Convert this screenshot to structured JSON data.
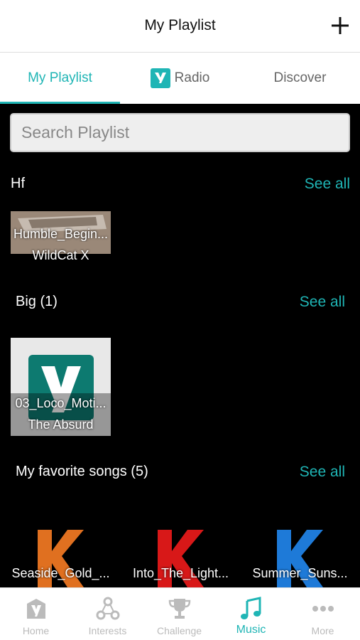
{
  "header": {
    "title": "My Playlist"
  },
  "tabs": [
    {
      "label": "My Playlist"
    },
    {
      "label": "Radio"
    },
    {
      "label": "Discover"
    }
  ],
  "search": {
    "placeholder": "Search Playlist"
  },
  "sections": [
    {
      "title": "Hf",
      "see_all": "See all",
      "items": [
        {
          "title": "Humble_Begin...",
          "artist": "WildCat X"
        }
      ]
    },
    {
      "title": "Big (1)",
      "see_all": "See all",
      "items": [
        {
          "title": "03_Loco_Moti...",
          "artist": "The Absurd"
        }
      ]
    },
    {
      "title": "My favorite songs (5)",
      "see_all": "See all",
      "items": [
        {
          "title": "Seaside_Gold_..."
        },
        {
          "title": "Into_The_Light..."
        },
        {
          "title": "Summer_Suns..."
        }
      ]
    }
  ],
  "bottom_nav": [
    {
      "label": "Home"
    },
    {
      "label": "Interests"
    },
    {
      "label": "Challenge"
    },
    {
      "label": "Music"
    },
    {
      "label": "More"
    }
  ],
  "colors": {
    "accent": "#1fb5b5",
    "background": "#000000"
  }
}
